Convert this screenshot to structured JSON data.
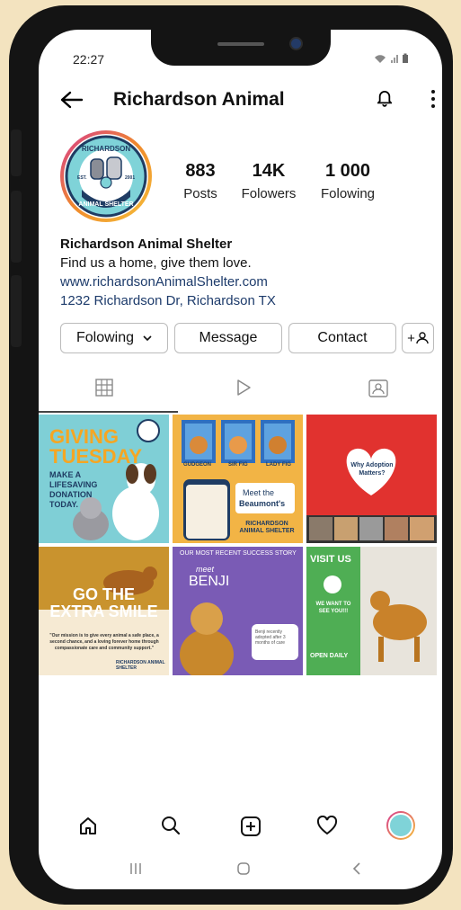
{
  "status": {
    "time": "22:27",
    "icons": "signal-wifi-battery"
  },
  "header": {
    "back_icon": "arrow-left-icon",
    "title": "Richardson Animal",
    "bell_icon": "bell-icon",
    "more_icon": "more-vertical-icon"
  },
  "avatar": {
    "logo_text_top": "RICHARDSON",
    "logo_text_bottom": "ANIMAL SHELTER",
    "est": "EST.",
    "year": "2001"
  },
  "stats": [
    {
      "value": "883",
      "label": "Posts"
    },
    {
      "value": "14K",
      "label": "Folowers"
    },
    {
      "value": "1 000",
      "label": "Folowing"
    }
  ],
  "bio": {
    "name": "Richardson Animal Shelter",
    "tagline": "Find us a home, give them love.",
    "website": "www.richardsonAnimalShelter.com",
    "address": "1232 Richardson Dr, Richardson TX"
  },
  "actions": {
    "following": "Folowing",
    "message": "Message",
    "contact": "Contact",
    "add_user_label": "+"
  },
  "tabs": [
    {
      "icon": "grid-icon"
    },
    {
      "icon": "play-icon"
    },
    {
      "icon": "tagged-icon"
    }
  ],
  "posts": [
    {
      "line1": "GIVING",
      "line2": "TUESDAY",
      "line3": "MAKE A LIFESAVING DONATION TODAY."
    },
    {
      "line1": "Meet the",
      "line2": "Beaumont's",
      "line3": "RICHARDSON ANIMAL SHELTER",
      "label_a": "GUDGEON",
      "label_b": "SIR FIG",
      "label_c": "LADY FIG"
    },
    {
      "title": "Why Adoption Matters?"
    },
    {
      "line1": "GO THE",
      "line2": "EXTRA SMILE",
      "quote": "\"Our mission is to give every animal a safe place, a second chance, and a loving forever home through compassionate care and community support.\"",
      "sign": "RICHARDSON ANIMAL SHELTER"
    },
    {
      "line1": "OUR MOST RECENT SUCCESS STORY",
      "line2": "meet",
      "line3": "BENJI",
      "note": "Benji recently adopted after 3 months of care"
    },
    {
      "line1": "VISIT US",
      "line2": "WE WANT TO SEE YOU!!!",
      "line3": "OPEN DAILY"
    }
  ],
  "bottom_nav": [
    "home-icon",
    "search-icon",
    "add-post-icon",
    "heart-icon",
    "profile-avatar"
  ],
  "system_nav": [
    "recents-icon",
    "home-circle-icon",
    "back-chevron-icon"
  ],
  "colors": {
    "accent_link": "#1d3b6b",
    "teal": "#6cc4c9",
    "orange": "#f0b23a",
    "red": "#e1322f",
    "purple": "#7a5bb5",
    "green": "#4fae54"
  }
}
